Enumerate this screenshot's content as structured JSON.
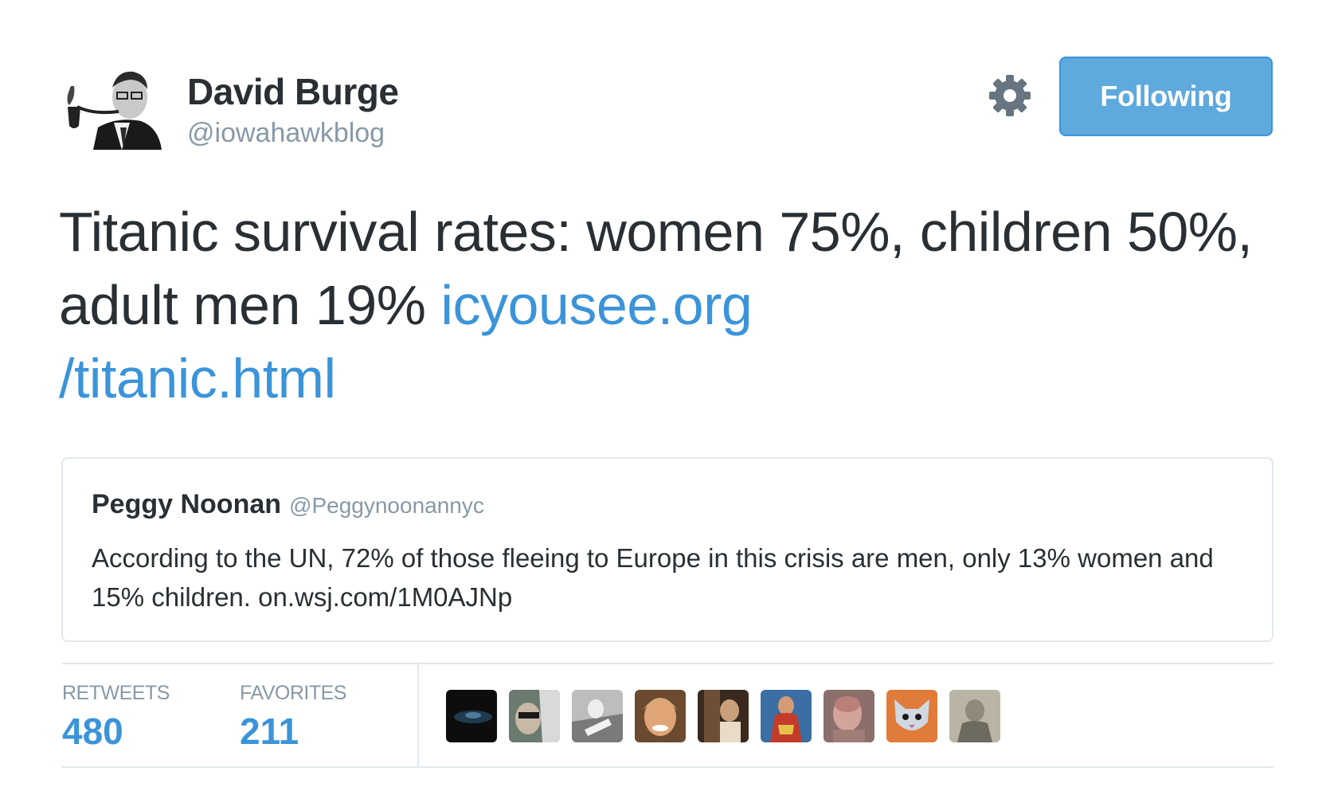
{
  "author": {
    "name": "David Burge",
    "handle": "@iowahawkblog"
  },
  "header": {
    "settings_icon": "gear-icon",
    "follow_label": "Following",
    "follow_color": "#5ea9dd"
  },
  "tweet": {
    "text": "Titanic survival rates: women 75%, children 50%, adult men 19%",
    "link_line1": "icyousee.org",
    "link_line2": "/titanic.html",
    "link_color": "#3b94d9"
  },
  "quoted_tweet": {
    "name": "Peggy Noonan",
    "handle": "@Peggynoonannyc",
    "text": "According to the UN, 72% of those fleeing to Europe in this crisis are men, only 13% women and 15% children. on.wsj.com/1M0AJNp"
  },
  "stats": {
    "retweets_label": "RETWEETS",
    "retweets_value": "480",
    "favorites_label": "FAVORITES",
    "favorites_value": "211"
  }
}
